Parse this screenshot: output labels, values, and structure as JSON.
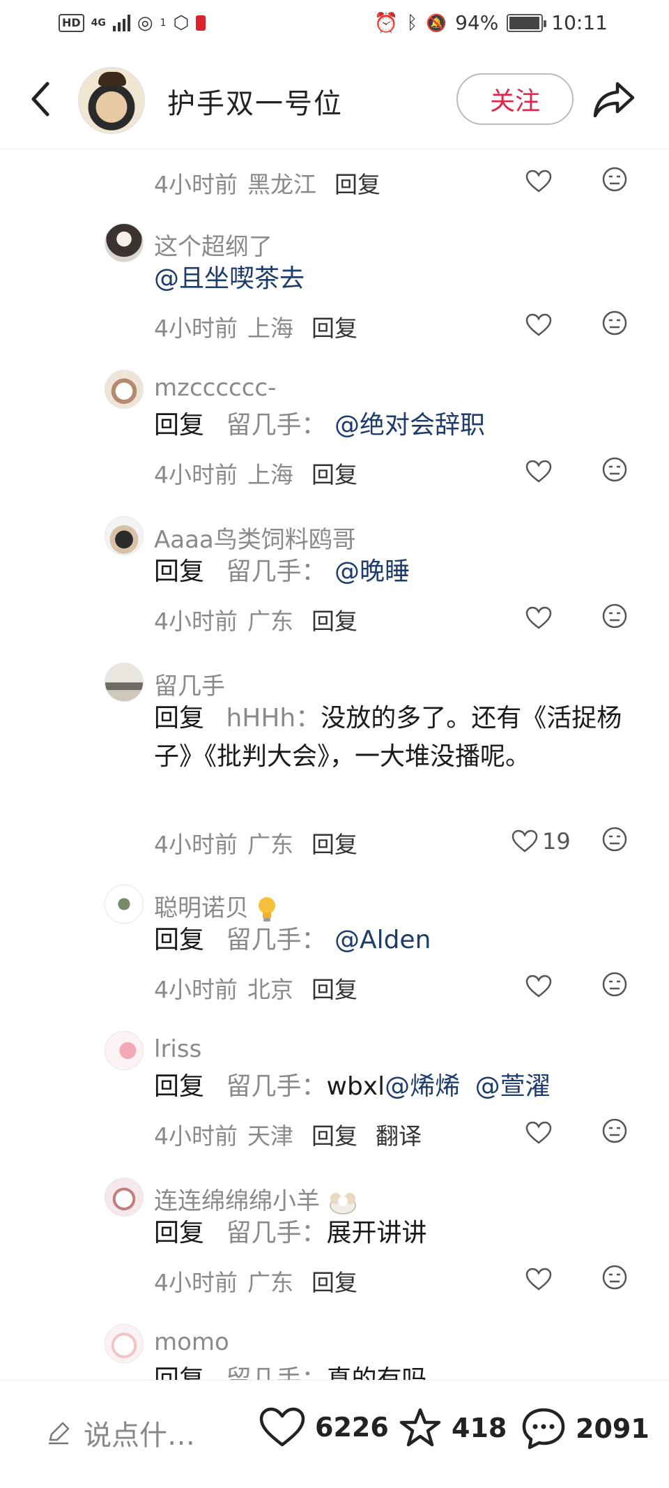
{
  "status_bar": {
    "network_label": "HD",
    "network_gen": "4G",
    "hotspot_count": "1",
    "battery": "94%",
    "time": "10:11"
  },
  "header": {
    "title": "护手双一号位",
    "follow_label": "关注"
  },
  "comments": [
    {
      "author": "",
      "time": "4小时前",
      "location": "黑龙江",
      "reply_label": "回复"
    },
    {
      "author": "这个超纲了",
      "mention": "@且坐喫茶去",
      "time": "4小时前",
      "location": "上海",
      "reply_label": "回复"
    },
    {
      "author": "mzcccccc-",
      "reply_prefix": "回复",
      "reply_to": "留几手",
      "colon": "：",
      "mention": "@绝对会辞职",
      "time": "4小时前",
      "location": "上海",
      "reply_label": "回复"
    },
    {
      "author": "Aaaa鸟类饲料鸥哥",
      "reply_prefix": "回复",
      "reply_to": "留几手",
      "colon": "：",
      "mention": "@晚睡",
      "time": "4小时前",
      "location": "广东",
      "reply_label": "回复"
    },
    {
      "author": "留几手",
      "reply_prefix": "回复",
      "reply_to": "hHHh",
      "colon": "：",
      "text": "没放的多了。还有《活捉杨子》《批判大会》，一大堆没播呢。",
      "time": "4小时前",
      "location": "广东",
      "reply_label": "回复",
      "likes": "19"
    },
    {
      "author": "聪明诺贝",
      "reply_prefix": "回复",
      "reply_to": "留几手",
      "colon": "：",
      "mention": "@Alden",
      "time": "4小时前",
      "location": "北京",
      "reply_label": "回复"
    },
    {
      "author": "lriss",
      "reply_prefix": "回复",
      "reply_to": "留几手",
      "colon": "：",
      "text": "wbxl",
      "mention": "@烯烯",
      "mention2": "@萱濯",
      "time": "4小时前",
      "location": "天津",
      "reply_label": "回复",
      "translate_label": "翻译"
    },
    {
      "author": "连连绵绵绵小羊",
      "reply_prefix": "回复",
      "reply_to": "留几手",
      "colon": "：",
      "text": "展开讲讲",
      "time": "4小时前",
      "location": "广东",
      "reply_label": "回复"
    },
    {
      "author": "momo",
      "reply_prefix": "回复",
      "reply_to": "留几手",
      "colon": "：",
      "text": "真的有吗"
    }
  ],
  "bottom_bar": {
    "compose_placeholder": "说点什…",
    "likes": "6226",
    "favorites": "418",
    "comments": "2091"
  },
  "colors": {
    "accent_red": "#e0254a",
    "mention_blue": "#1d3c6b",
    "meta_gray": "#8a8a8a"
  },
  "icons": [
    "back-arrow-icon",
    "share-icon",
    "heart-icon",
    "dislike-face-icon",
    "star-icon",
    "comment-bubble-icon",
    "pencil-icon",
    "lightbulb-emoji",
    "sheep-emoji"
  ]
}
